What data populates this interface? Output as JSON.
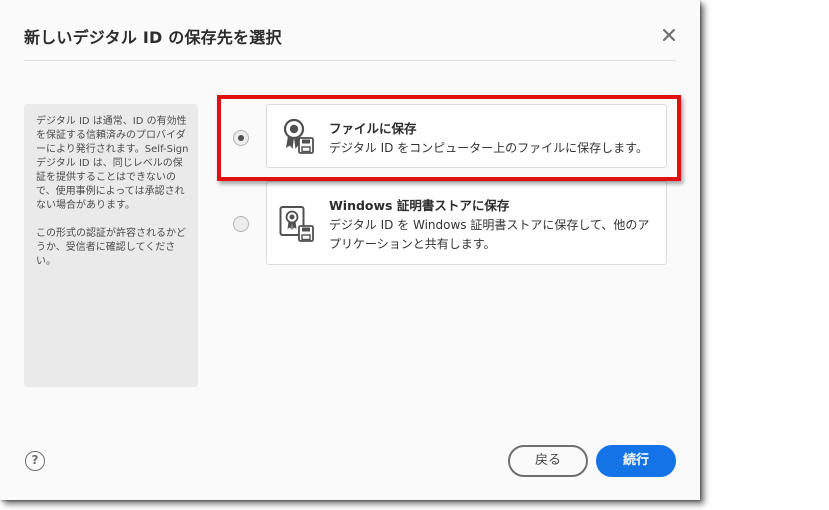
{
  "dialog": {
    "title": "新しいデジタル ID の保存先を選択"
  },
  "info_panel": {
    "paragraph_1": "デジタル ID は通常、ID の有効性を保証する信頼済みのプロバイダーにより発行されます。Self-Sign デジタル ID は、同じレベルの保証を提供することはできないので、使用事例によっては承認されない場合があります。",
    "paragraph_2": "この形式の認証が許容されるかどうか、受信者に確認してください。"
  },
  "options": [
    {
      "title": "ファイルに保存",
      "description": "デジタル ID をコンピューター上のファイルに保存します。",
      "selected": true,
      "icon": "certificate-file-icon"
    },
    {
      "title": "Windows 証明書ストアに保存",
      "description": "デジタル ID を Windows 証明書ストアに保存して、他のアプリケーションと共有します。",
      "selected": false,
      "icon": "certificate-store-icon"
    }
  ],
  "footer": {
    "help_symbol": "?",
    "back_label": "戻る",
    "continue_label": "続行"
  },
  "colors": {
    "primary_button": "#1473e6",
    "highlight_border": "#e01010",
    "info_panel_bg": "#eaeaea"
  }
}
